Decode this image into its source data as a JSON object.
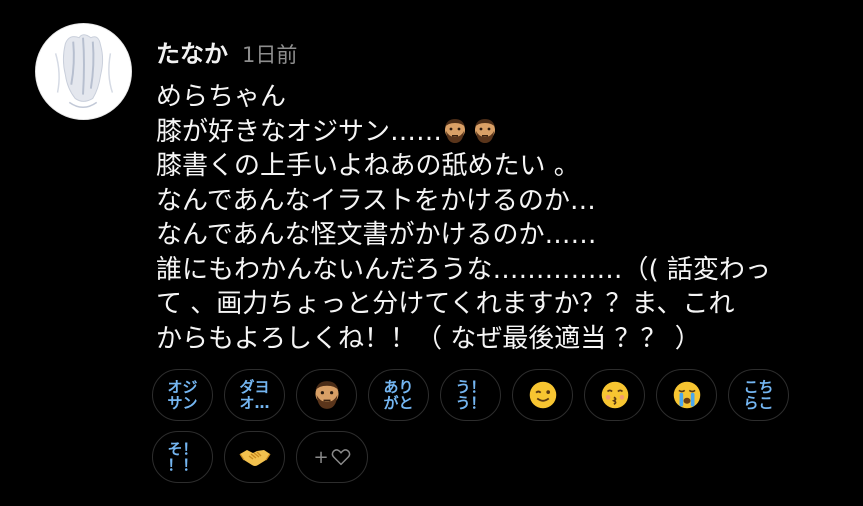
{
  "comment": {
    "username": "たなか",
    "timestamp": "1日前",
    "lines": [
      "めらちゃん",
      "膝が好きなオジサン……",
      "膝書くの上手いよねあの舐めたい 。",
      "なんであんなイラストをかけるのか…",
      "なんであんな怪文書がかけるのか……",
      "誰にもわかんないんだろうな……………（( 話変わっ",
      "て 、画力ちょっと分けてくれますか？？ま、これ",
      "からもよろしくね！！（ なぜ最後適当 ？？ ）"
    ],
    "line2_emojis": [
      "bearded-man-emoji",
      "bearded-man-emoji"
    ]
  },
  "reactions": [
    {
      "type": "text",
      "label": "オジ\nサン",
      "name": "reaction-ojisan"
    },
    {
      "type": "text",
      "label": "ダヨ\nオ…",
      "name": "reaction-dayoo"
    },
    {
      "type": "emoji",
      "icon": "bearded-man-icon",
      "name": "reaction-bearded-man"
    },
    {
      "type": "text",
      "label": "あり\nがと",
      "name": "reaction-arigato"
    },
    {
      "type": "text",
      "label": "う！\nう！",
      "name": "reaction-uu"
    },
    {
      "type": "emoji",
      "icon": "winking-face-icon",
      "name": "reaction-wink"
    },
    {
      "type": "emoji",
      "icon": "kissing-face-icon",
      "name": "reaction-kiss"
    },
    {
      "type": "emoji",
      "icon": "crying-face-icon",
      "name": "reaction-crying"
    },
    {
      "type": "text",
      "label": "こち\nらこ",
      "name": "reaction-kochirakoso"
    },
    {
      "type": "text",
      "label": "そ！\n！！",
      "name": "reaction-so"
    },
    {
      "type": "emoji",
      "icon": "handshake-icon",
      "name": "reaction-handshake"
    },
    {
      "type": "add",
      "label": "+",
      "icon": "heart-outline-icon",
      "name": "add-reaction-button"
    }
  ],
  "colors": {
    "background": "#000000",
    "reaction_text": "#74b6f2",
    "timestamp": "#8e8e8e",
    "chip_border": "#2d2d2d"
  }
}
